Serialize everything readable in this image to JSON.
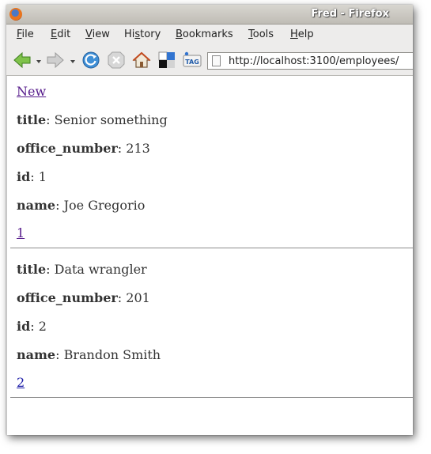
{
  "window": {
    "title": "Fred - Firefox"
  },
  "menu": {
    "file": {
      "u": "F",
      "rest": "ile"
    },
    "edit": {
      "u": "E",
      "rest": "dit"
    },
    "view": {
      "u": "V",
      "rest": "iew"
    },
    "history": {
      "pre": "Hi",
      "u": "s",
      "rest": "tory"
    },
    "bookmarks": {
      "u": "B",
      "rest": "ookmarks"
    },
    "tools": {
      "u": "T",
      "rest": "ools"
    },
    "help": {
      "u": "H",
      "rest": "elp"
    }
  },
  "toolbar": {
    "url": "http://localhost:3100/employees/",
    "icons": [
      "back-icon",
      "forward-icon",
      "reload-icon",
      "stop-icon",
      "home-icon",
      "delicious-icon",
      "tag-icon"
    ],
    "tag_label": "TAG"
  },
  "page": {
    "new_link": "New",
    "separator": ": ",
    "employees": [
      {
        "title_label": "title",
        "title": "Senior something",
        "office_label": "office_number",
        "office_number": "213",
        "id_label": "id",
        "id": "1",
        "name_label": "name",
        "name": "Joe Gregorio",
        "link": "1"
      },
      {
        "title_label": "title",
        "title": "Data wrangler",
        "office_label": "office_number",
        "office_number": "201",
        "id_label": "id",
        "id": "2",
        "name_label": "name",
        "name": "Brandon Smith",
        "link": "2"
      }
    ]
  }
}
